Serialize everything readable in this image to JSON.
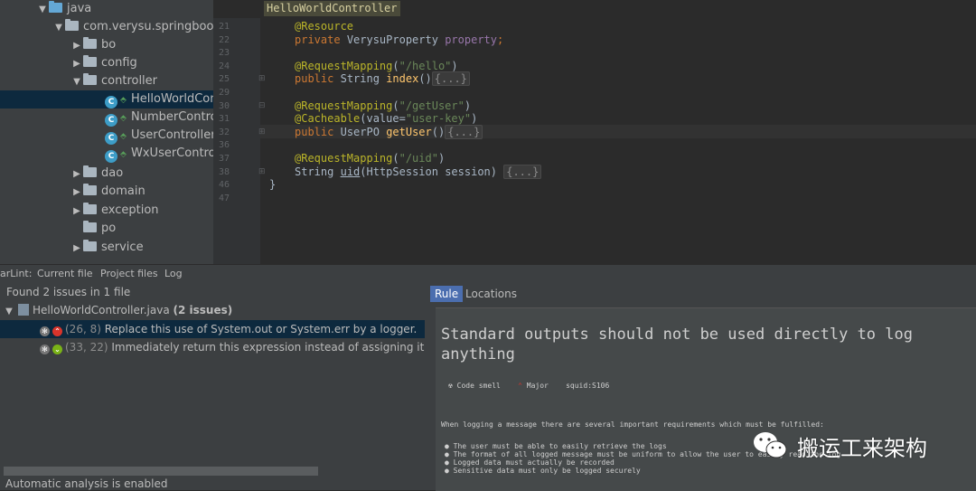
{
  "project_tree": {
    "items": [
      {
        "label": "java",
        "arrow": "▼"
      },
      {
        "label": "com.verysu.springboot",
        "arrow": "▼"
      },
      {
        "label": "bo",
        "arrow": "▶"
      },
      {
        "label": "config",
        "arrow": "▶"
      },
      {
        "label": "controller",
        "arrow": "▼"
      },
      {
        "label": "HelloWorldController",
        "class_icon": "C"
      },
      {
        "label": "NumberController",
        "class_icon": "C"
      },
      {
        "label": "UserController",
        "class_icon": "C"
      },
      {
        "label": "WxUserController",
        "class_icon": "C"
      },
      {
        "label": "dao",
        "arrow": "▶"
      },
      {
        "label": "domain",
        "arrow": "▶"
      },
      {
        "label": "exception",
        "arrow": "▶"
      },
      {
        "label": "po",
        "arrow": ""
      },
      {
        "label": "service",
        "arrow": "▶"
      }
    ]
  },
  "editor": {
    "tab_title": "HelloWorldController",
    "lines": [
      {
        "n": "21",
        "ann": "@Resource"
      },
      {
        "n": "22",
        "kw": "private",
        "type": "VerysuProperty",
        "field": "property",
        "end": ";"
      },
      {
        "n": "23"
      },
      {
        "n": "24",
        "ann": "@RequestMapping",
        "str": "\"/hello\""
      },
      {
        "n": "25",
        "kw": "public",
        "type": "String",
        "fn": "index",
        "folded": "{...}"
      },
      {
        "n": "29"
      },
      {
        "n": "30",
        "ann": "@RequestMapping",
        "str": "\"/getUser\""
      },
      {
        "n": "31",
        "ann": "@Cacheable",
        "param": "value=",
        "str": "\"user-key\""
      },
      {
        "n": "32",
        "kw": "public",
        "type": "UserPO",
        "fn": "getUser",
        "folded": "{...}"
      },
      {
        "n": "36"
      },
      {
        "n": "37",
        "ann": "@RequestMapping",
        "str": "\"/uid\""
      },
      {
        "n": "38",
        "type": "String",
        "fn": "uid",
        "params": "(HttpSession session)",
        "folded": "{...}"
      },
      {
        "n": "46",
        "text": "}"
      },
      {
        "n": "47"
      }
    ]
  },
  "tool_tabs": [
    "arLint:",
    "Current file",
    "Project files",
    "Log"
  ],
  "issues": {
    "summary": "Found 2 issues in 1 file",
    "file": "HelloWorldController.java",
    "file_count": "(2 issues)",
    "items": [
      {
        "pos": "(26, 8)",
        "text": "Replace this use of System.out or System.err by a logger.",
        "severity_color": "#d9342b"
      },
      {
        "pos": "(33, 22)",
        "text": "Immediately return this expression instead of assigning it to the",
        "severity_color": "#7ab317"
      }
    ],
    "status": "Automatic analysis is enabled"
  },
  "rule_panel": {
    "tabs": [
      "Rule",
      "Locations"
    ],
    "title": "Standard outputs should not be used directly to log anything",
    "type": "Code smell",
    "severity": "Major",
    "key": "squid:S106",
    "description": "When logging a message there are several important requirements which must be fulfilled:",
    "bullets": [
      "The user must be able to easily retrieve the logs",
      "The format of all logged message must be uniform to allow the user to easily read the log",
      "Logged data must actually be recorded",
      "Sensitive data must only be logged securely"
    ]
  },
  "watermark": {
    "text": "搬运工来架构"
  }
}
